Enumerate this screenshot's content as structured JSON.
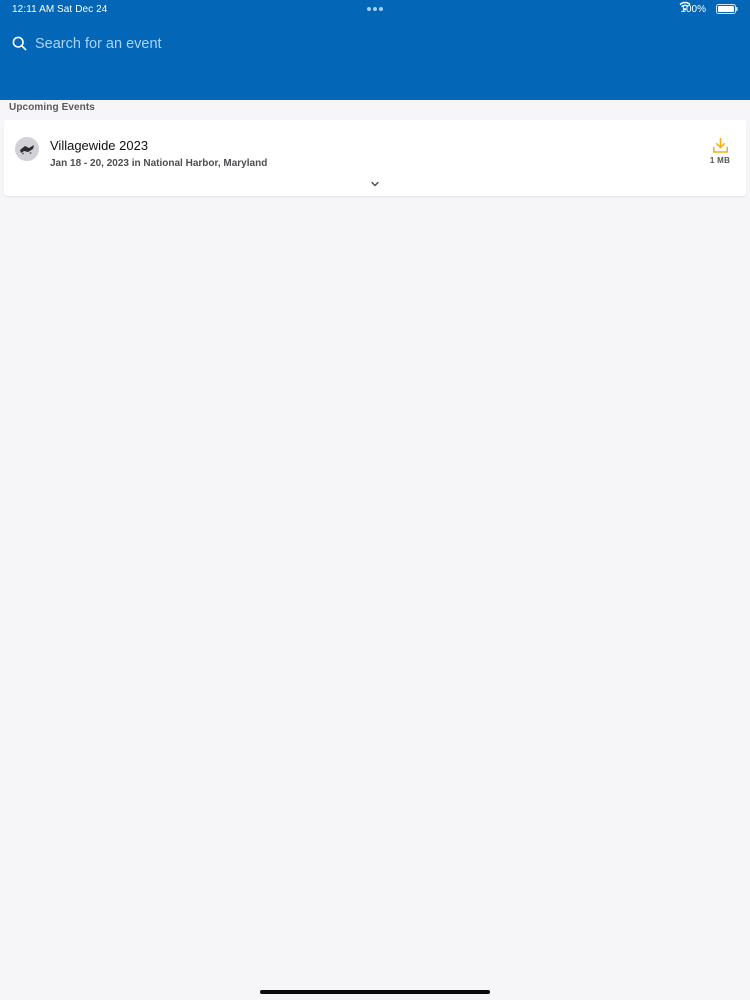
{
  "status_bar": {
    "time": "12:11 AM",
    "date": "Sat Dec 24",
    "battery_percent": "100%"
  },
  "search": {
    "placeholder": "Search for an event"
  },
  "sections": {
    "upcoming_title": "Upcoming Events"
  },
  "events": [
    {
      "title": "Villagewide 2023",
      "subtitle": "Jan 18 - 20, 2023 in National Harbor, Maryland",
      "download_size": "1 MB"
    }
  ],
  "icons": {
    "search": "search-icon",
    "wifi": "wifi-icon",
    "battery": "battery-icon",
    "download": "download-icon",
    "chevron": "chevron-down-icon"
  },
  "colors": {
    "header_blue": "#0466b6",
    "background": "#f6f6f8",
    "download_accent": "#f2b01e"
  }
}
